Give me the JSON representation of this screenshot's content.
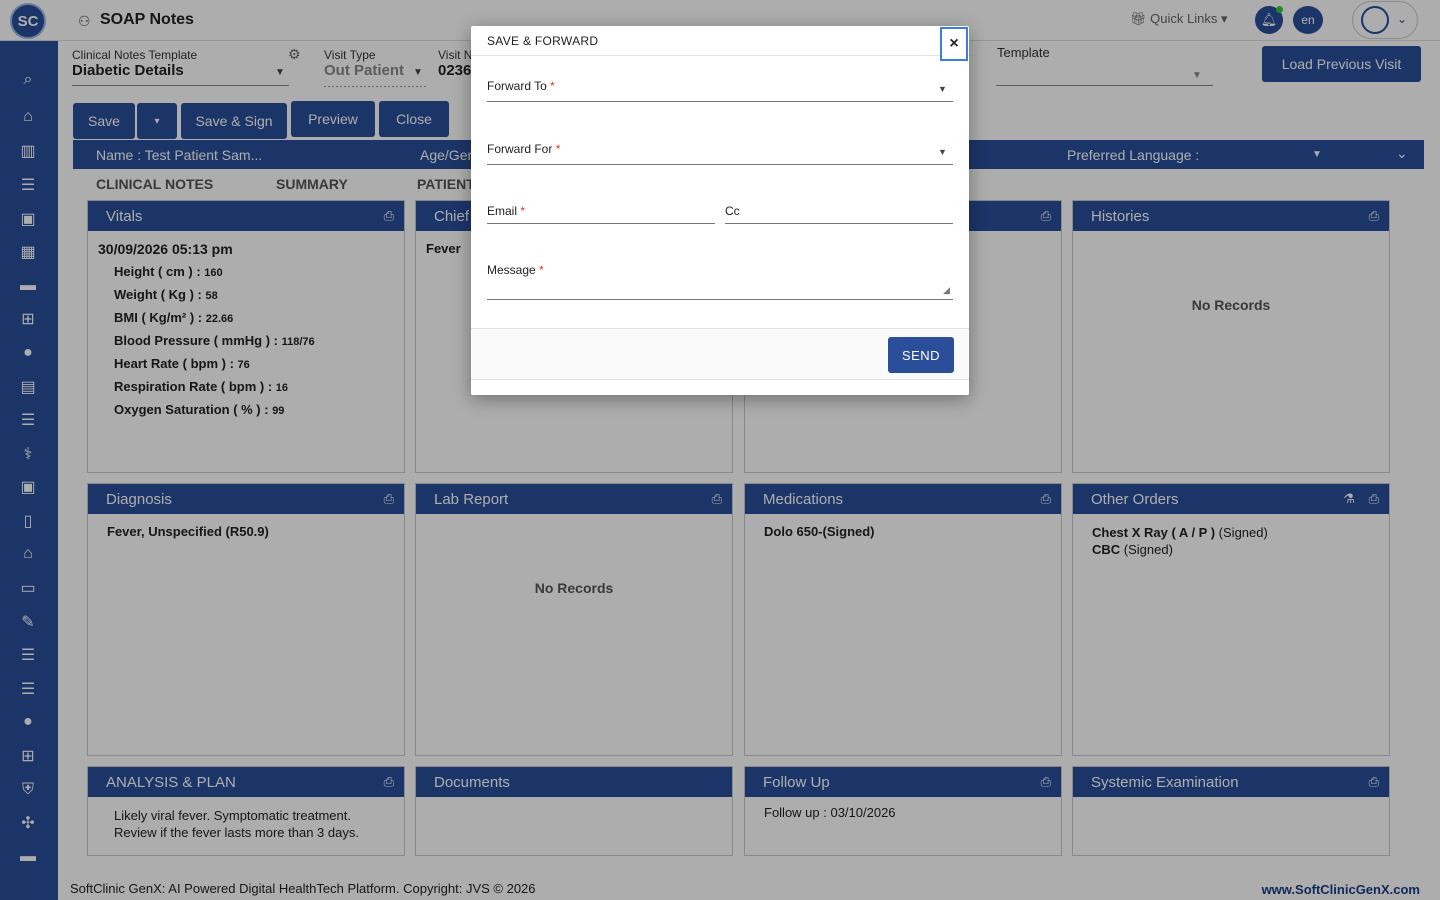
{
  "app": {
    "logo_text": "SC",
    "page_title": "SOAP Notes",
    "quick_links": "Quick Links",
    "language": "en"
  },
  "header": {
    "template_label": "Clinical Notes Template",
    "template_value": "Diabetic Details",
    "visit_type_label": "Visit Type",
    "visit_type_value": "Out Patient",
    "visit_no_label": "Visit N",
    "visit_no_value": "0236",
    "template2_label": "Template",
    "load_previous": "Load Previous Visit"
  },
  "toolbar": {
    "save": "Save",
    "save_sign": "Save & Sign",
    "preview": "Preview",
    "close": "Close"
  },
  "patient_bar": {
    "name": "Name :  Test Patient Sam...",
    "age": "Age/Ger",
    "preferred_language": "Preferred Language :"
  },
  "tabs": [
    "CLINICAL NOTES",
    "SUMMARY",
    "PATIENT"
  ],
  "cards": {
    "vitals": {
      "title": "Vitals",
      "date": "30/09/2026 05:13 pm",
      "rows": [
        {
          "label": "Height ( cm ) : ",
          "value": "160"
        },
        {
          "label": "Weight ( Kg ) : ",
          "value": "58"
        },
        {
          "label": "BMI ( Kg/m² ) : ",
          "value": "22.66"
        },
        {
          "label": "Blood Pressure ( mmHg ) : ",
          "value": "118/76"
        },
        {
          "label": "Heart Rate ( bpm ) : ",
          "value": "76"
        },
        {
          "label": "Respiration Rate ( bpm ) : ",
          "value": "16"
        },
        {
          "label": "Oxygen Saturation ( % ) : ",
          "value": "99"
        }
      ]
    },
    "chief": {
      "title": "Chief",
      "text": "Fever"
    },
    "histories": {
      "title": "Histories",
      "empty": "No Records"
    },
    "diagnosis": {
      "title": "Diagnosis",
      "text": "Fever, Unspecified (R50.9)"
    },
    "lab": {
      "title": "Lab Report",
      "empty": "No Records"
    },
    "medications": {
      "title": "Medications",
      "text": "Dolo 650-(Signed)"
    },
    "other_orders": {
      "title": "Other Orders",
      "row1_name": "Chest X Ray ( A / P )",
      "row1_status": " (Signed)",
      "row2_name": "CBC",
      "row2_status": " (Signed)"
    },
    "analysis": {
      "title": "ANALYSIS & PLAN",
      "line1": "Likely viral fever. Symptomatic treatment.",
      "line2": "Review if the fever lasts more than 3 days."
    },
    "documents": {
      "title": "Documents"
    },
    "followup": {
      "title": "Follow Up",
      "text": "Follow up : 03/10/2026"
    },
    "systemic": {
      "title": "Systemic Examination"
    }
  },
  "footer": {
    "left": "SoftClinic GenX: AI Powered Digital HealthTech Platform. Copyright: JVS © 2026",
    "right": "www.SoftClinicGenX.com"
  },
  "modal": {
    "title": "SAVE & FORWARD",
    "forward_to": "Forward To",
    "forward_for": "Forward For",
    "email": "Email",
    "cc": "Cc",
    "message": "Message",
    "required_mark": "*",
    "send": "SEND",
    "close_glyph": "×"
  }
}
